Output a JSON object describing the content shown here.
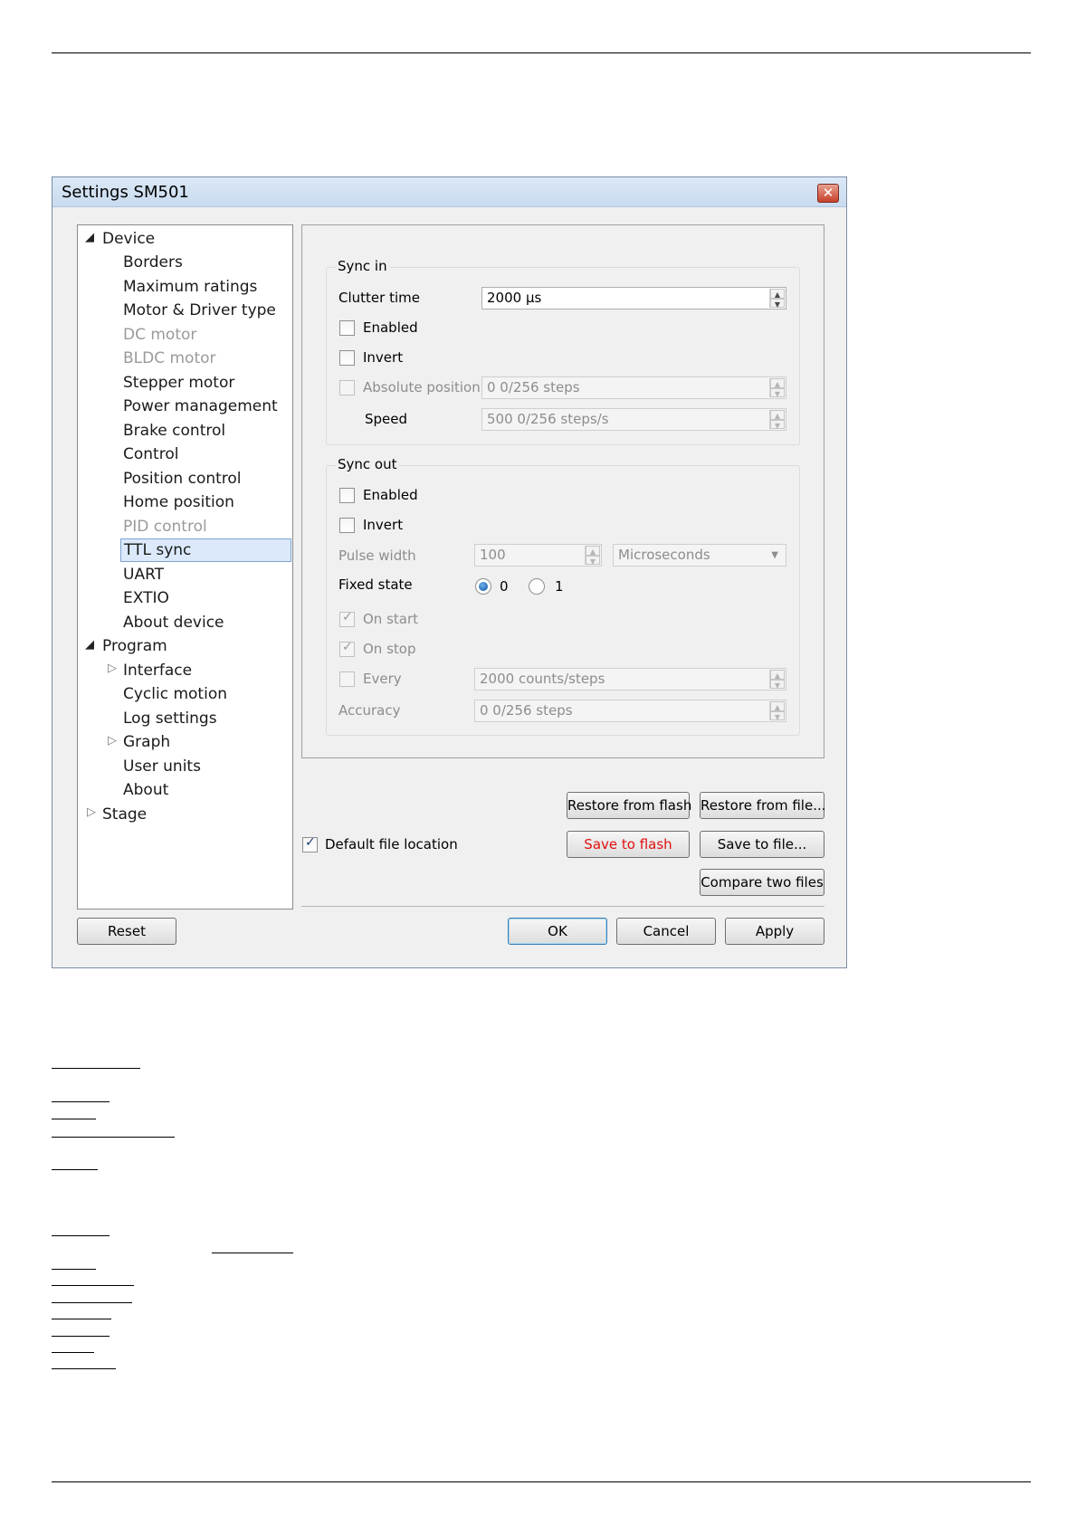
{
  "window": {
    "title": "Settings SM501",
    "close_glyph": "✕"
  },
  "tree": {
    "items": [
      {
        "label": "Device"
      },
      {
        "label": "Borders"
      },
      {
        "label": "Maximum ratings"
      },
      {
        "label": "Motor & Driver type"
      },
      {
        "label": "DC motor"
      },
      {
        "label": "BLDC motor"
      },
      {
        "label": "Stepper motor"
      },
      {
        "label": "Power management"
      },
      {
        "label": "Brake control"
      },
      {
        "label": "Control"
      },
      {
        "label": "Position control"
      },
      {
        "label": "Home position"
      },
      {
        "label": "PID control"
      },
      {
        "label": "TTL sync"
      },
      {
        "label": "UART"
      },
      {
        "label": "EXTIO"
      },
      {
        "label": "About device"
      },
      {
        "label": "Program"
      },
      {
        "label": "Interface"
      },
      {
        "label": "Cyclic motion"
      },
      {
        "label": "Log settings"
      },
      {
        "label": "Graph"
      },
      {
        "label": "User units"
      },
      {
        "label": "About"
      },
      {
        "label": "Stage"
      }
    ]
  },
  "sync_in": {
    "title": "Sync in",
    "clutter_time_label": "Clutter time",
    "clutter_time_value": "2000 µs",
    "enabled_label": "Enabled",
    "invert_label": "Invert",
    "absolute_position_label": "Absolute position",
    "absolute_position_value": "0 0/256 steps",
    "speed_label": "Speed",
    "speed_value": "500 0/256 steps/s"
  },
  "sync_out": {
    "title": "Sync out",
    "enabled_label": "Enabled",
    "invert_label": "Invert",
    "pulse_width_label": "Pulse width",
    "pulse_width_value": "100",
    "pulse_width_unit": "Microseconds",
    "fixed_state_label": "Fixed state",
    "fixed_state_option_0": "0",
    "fixed_state_option_1": "1",
    "on_start_label": "On start",
    "on_stop_label": "On stop",
    "every_label": "Every",
    "every_value": "2000 counts/steps",
    "accuracy_label": "Accuracy",
    "accuracy_value": "0 0/256 steps"
  },
  "file_actions": {
    "restore_from_flash": "Restore from flash",
    "restore_from_file": "Restore from file...",
    "default_file_location": "Default file location",
    "save_to_flash": "Save to flash",
    "save_to_file": "Save to file...",
    "compare_two_files": "Compare two files"
  },
  "footer": {
    "reset": "Reset",
    "ok": "OK",
    "cancel": "Cancel",
    "apply": "Apply"
  }
}
